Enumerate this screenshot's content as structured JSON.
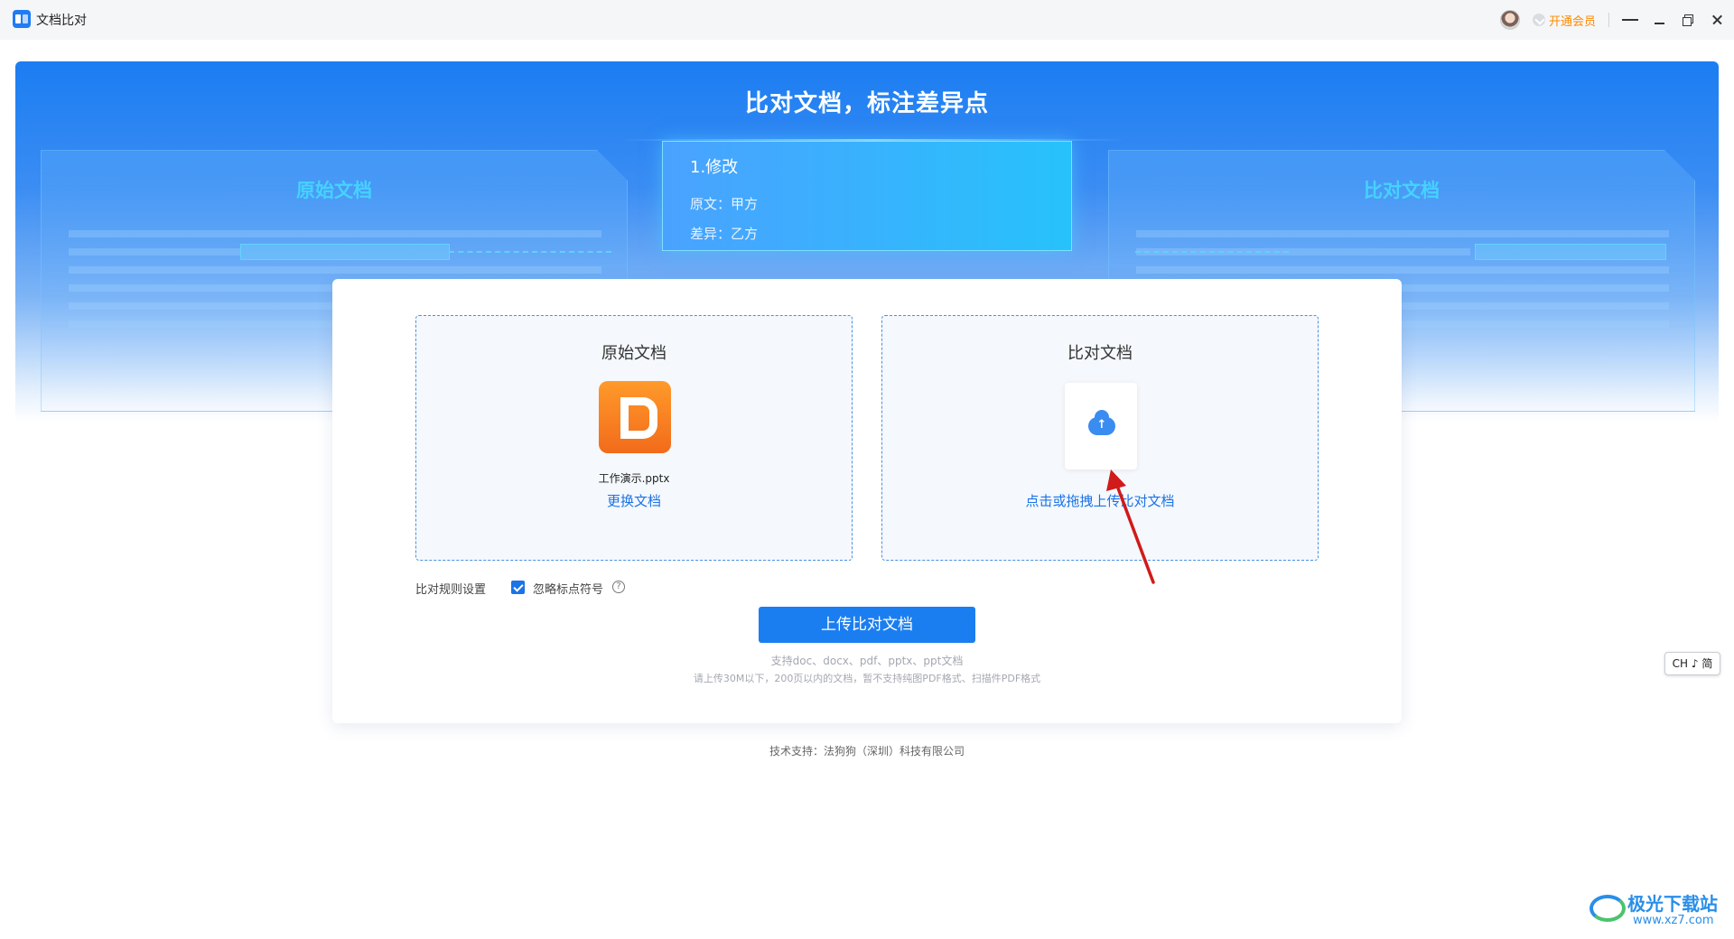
{
  "titlebar": {
    "app_title": "文档比对",
    "vip_label": "开通会员",
    "icons": [
      "avatar",
      "vip-icon",
      "menu-icon",
      "minimize-icon",
      "restore-icon",
      "close-icon"
    ]
  },
  "hero": {
    "title": "比对文档，标注差异点",
    "left_panel_title": "原始文档",
    "right_panel_title": "比对文档",
    "diff_card": {
      "heading": "1.修改",
      "original_row": "原文：甲方",
      "diff_row": "差异：乙方"
    }
  },
  "upload": {
    "original": {
      "title": "原始文档",
      "file_name": "工作演示.pptx",
      "change_label": "更换文档",
      "icon": "pptx-file-icon"
    },
    "compare": {
      "title": "比对文档",
      "upload_label": "点击或拖拽上传比对文档",
      "icon": "cloud-upload-icon"
    },
    "rules_label": "比对规则设置",
    "ignore_punct_label": "忽略标点符号",
    "ignore_punct_checked": true,
    "upload_button": "上传比对文档",
    "hint_formats": "支持doc、docx、pdf、pptx、ppt文档",
    "hint_limits": "请上传30M以下，200页以内的文档，暂不支持纯图PDF格式、扫描件PDF格式"
  },
  "footer": "技术支持：法狗狗（深圳）科技有限公司",
  "ime_indicator": "CH ♪ 简",
  "watermark": {
    "title": "极光下载站",
    "url": "www.xz7.com"
  },
  "colors": {
    "accent": "#1b7ef0",
    "vip": "#ff8a00",
    "link": "#1a73e8",
    "annotation_arrow": "#d11a1a"
  }
}
